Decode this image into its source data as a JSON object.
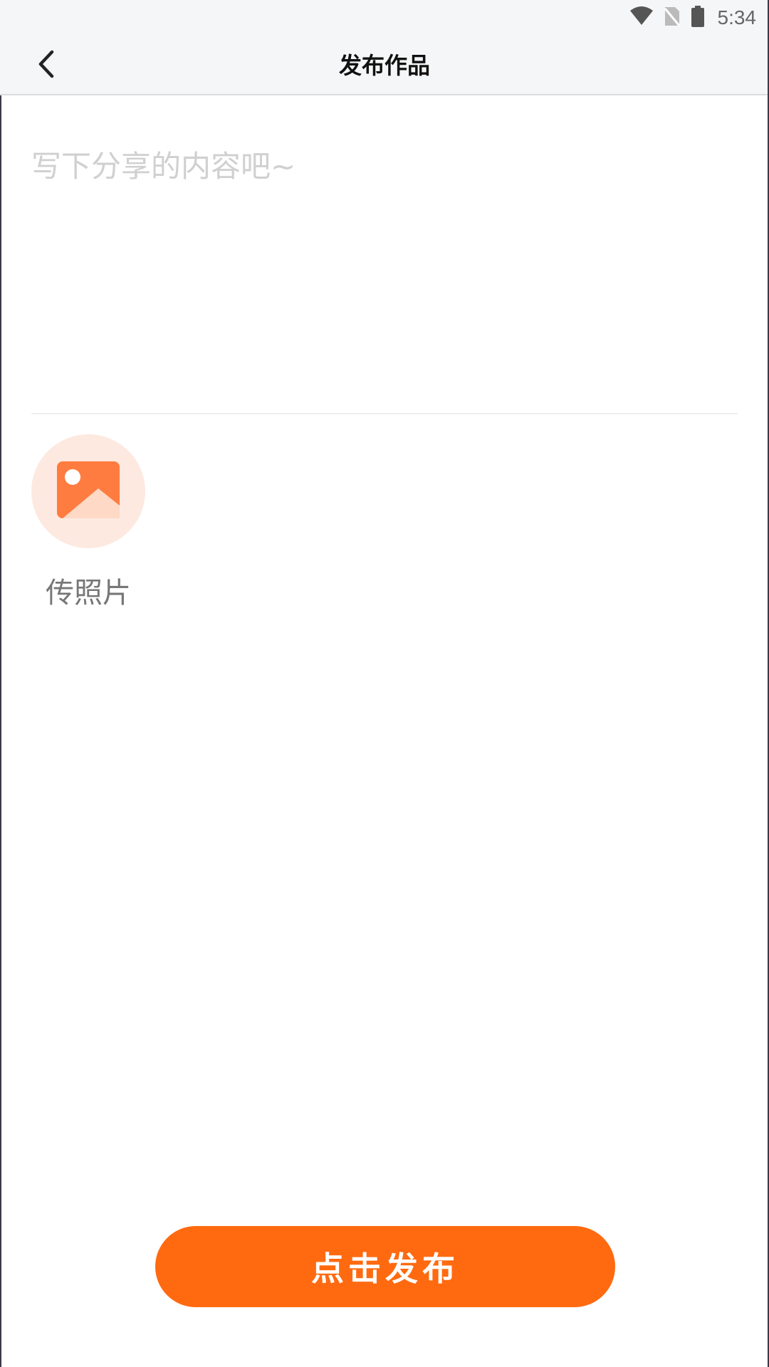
{
  "status_bar": {
    "time": "5:34",
    "icons": [
      "wifi-icon",
      "no-sim-icon",
      "battery-icon"
    ]
  },
  "header": {
    "back_icon": "chevron-left-icon",
    "title": "发布作品"
  },
  "editor": {
    "placeholder": "写下分享的内容吧~",
    "value": ""
  },
  "upload": {
    "icon": "image-icon",
    "label": "传照片"
  },
  "publish": {
    "label": "点击发布"
  },
  "colors": {
    "accent": "#ff6a10",
    "upload_bg": "#fde9e0",
    "icon_orange": "#ff7c40",
    "header_bg": "#f5f6f7"
  }
}
